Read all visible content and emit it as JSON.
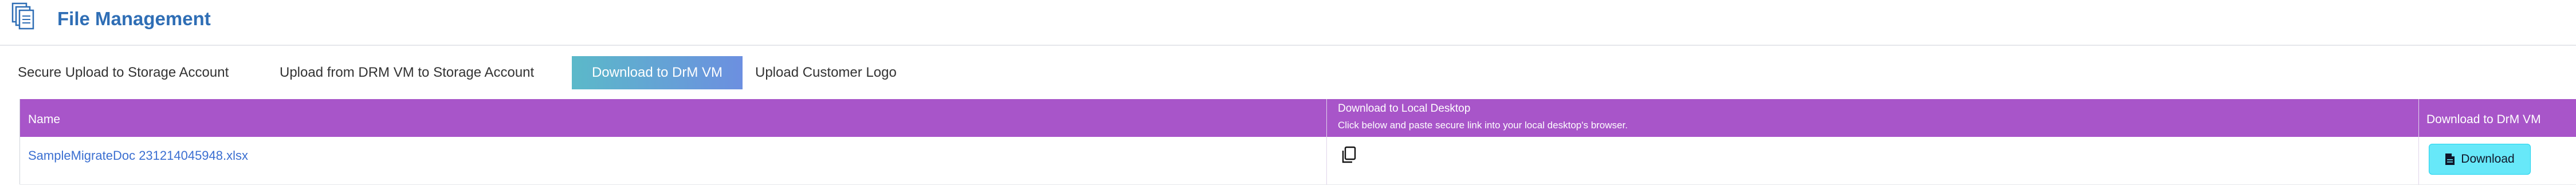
{
  "header": {
    "title": "File Management",
    "icon": "documents-icon"
  },
  "tabs": [
    {
      "label": "Secure Upload to Storage Account",
      "active": false
    },
    {
      "label": "Upload from DRM VM to Storage Account",
      "active": false
    },
    {
      "label": "Download to DrM VM",
      "active": true
    },
    {
      "label": "Upload Customer Logo",
      "active": false
    }
  ],
  "table": {
    "columns": {
      "name": "Name",
      "local_title": "Download to Local Desktop",
      "local_subtitle": "Click below and paste secure link into your local desktop's browser.",
      "drm": "Download to DrM VM"
    },
    "rows": [
      {
        "file_name": "SampleMigrateDoc 231214045948.xlsx",
        "copy_icon": "copy-icon",
        "download_label": "Download",
        "download_icon": "file-icon"
      }
    ]
  },
  "colors": {
    "title": "#2f6eb5",
    "table_header": "#a855c9",
    "active_tab_start": "#5bb9c9",
    "active_tab_end": "#6c8fe0",
    "download_button": "#67e8f9",
    "link": "#3b6fd1"
  }
}
